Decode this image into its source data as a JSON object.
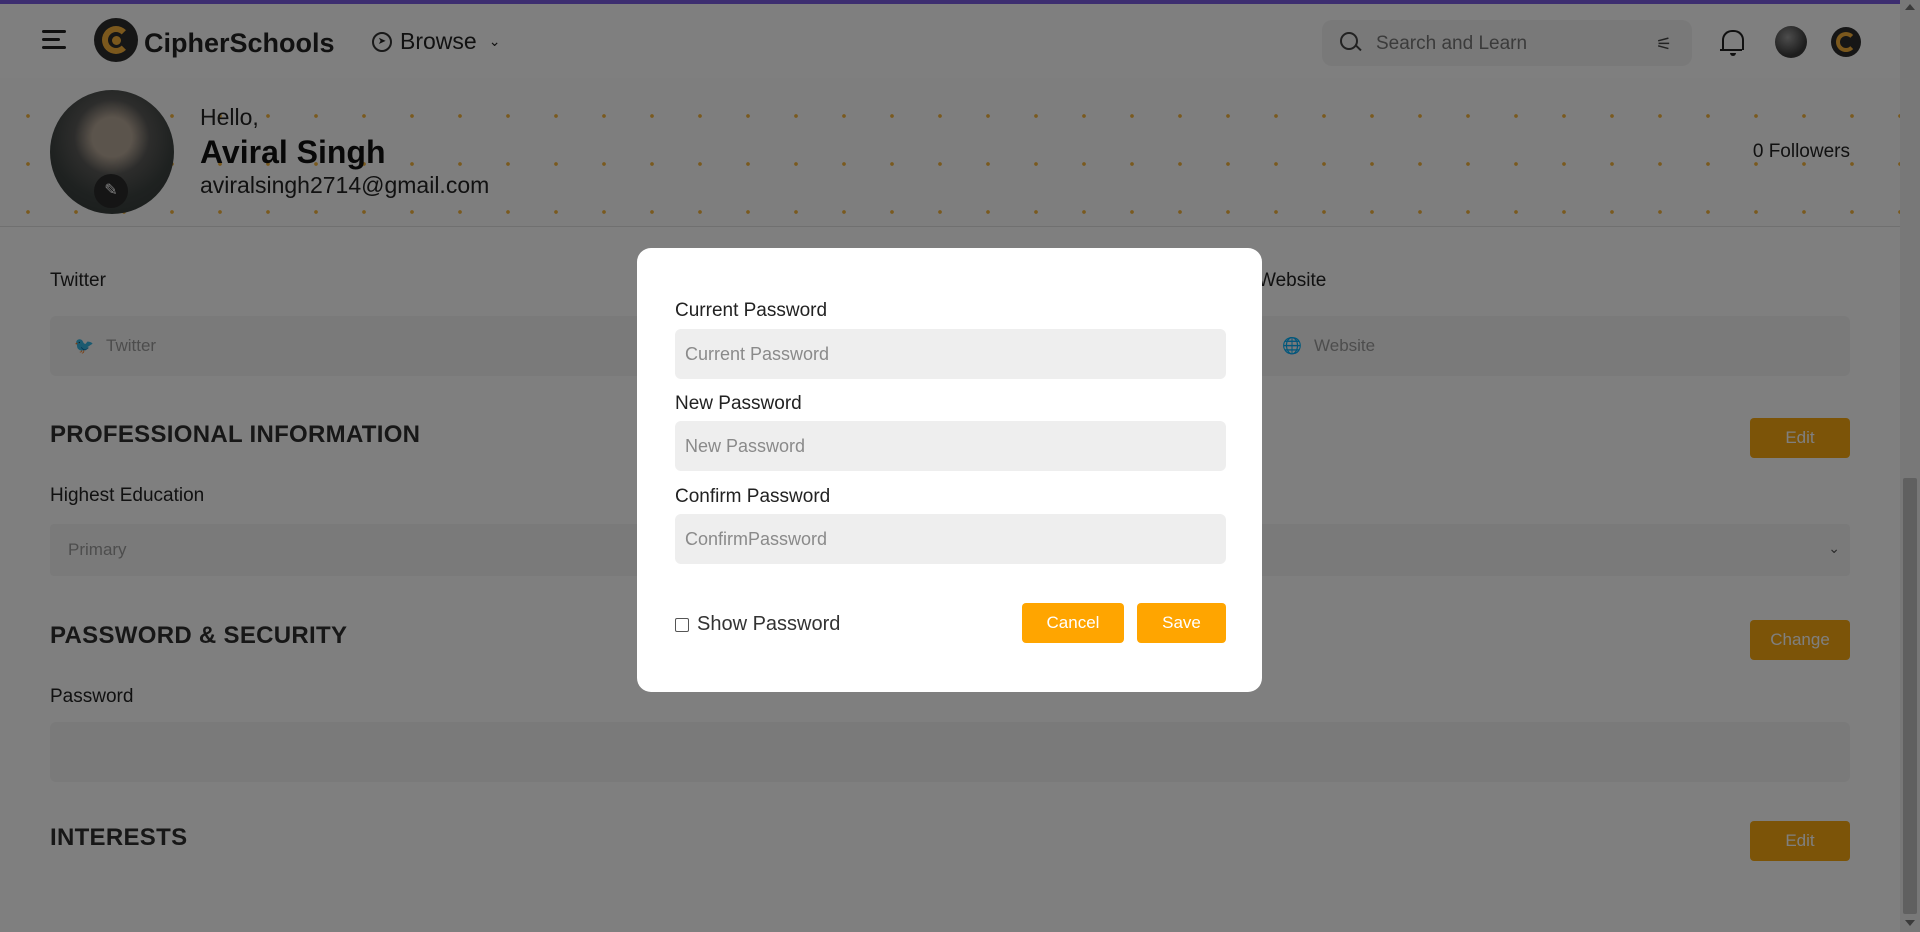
{
  "header": {
    "brand": "CipherSchools",
    "browse_label": "Browse",
    "search_placeholder": "Search and Learn"
  },
  "profile": {
    "greeting": "Hello,",
    "name": "Aviral Singh",
    "email": "aviralsingh2714@gmail.com",
    "followers": "0 Followers"
  },
  "links": {
    "twitter_label": "Twitter",
    "twitter_placeholder": "Twitter",
    "website_label": "Website",
    "website_placeholder": "Website"
  },
  "professional": {
    "title": "PROFESSIONAL INFORMATION",
    "edit_label": "Edit",
    "education_label": "Highest Education",
    "education_value": "Primary"
  },
  "security": {
    "title": "PASSWORD & SECURITY",
    "change_label": "Change",
    "password_label": "Password"
  },
  "interests": {
    "title": "INTERESTS",
    "edit_label": "Edit"
  },
  "modal": {
    "current_label": "Current Password",
    "current_placeholder": "Current Password",
    "new_label": "New Password",
    "new_placeholder": "New Password",
    "confirm_label": "Confirm Password",
    "confirm_placeholder": "ConfirmPassword",
    "show_password_label": "Show Password",
    "cancel_label": "Cancel",
    "save_label": "Save"
  },
  "colors": {
    "accent": "#ffa500",
    "topline": "#7b5ce1"
  }
}
